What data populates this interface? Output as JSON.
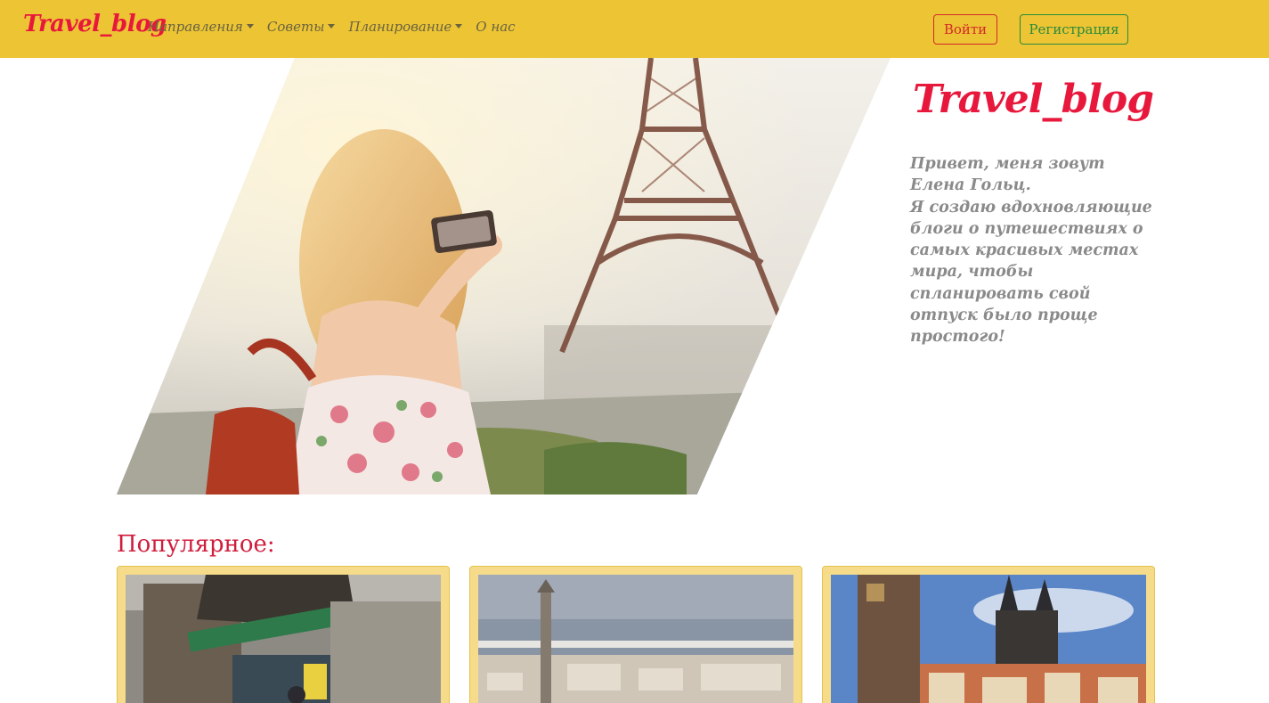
{
  "navbar": {
    "brand": "Travel_blog",
    "items": [
      {
        "label": "Направления",
        "dropdown": true
      },
      {
        "label": "Советы",
        "dropdown": true
      },
      {
        "label": "Планирование",
        "dropdown": true
      },
      {
        "label": "О нас",
        "dropdown": false
      }
    ],
    "login_label": "Войти",
    "register_label": "Регистрация"
  },
  "hero": {
    "title": "Travel_blog",
    "lines": [
      "Привет, меня зовут Елена Гольц.",
      "Я создаю вдохновляющие блоги о путешествиях о самых красивых местах мира, чтобы спланировать свой отпуск было проще простого!"
    ]
  },
  "popular": {
    "title": "Популярное:",
    "cards": [
      {
        "image": "city-street-photo"
      },
      {
        "image": "harbor-city-photo"
      },
      {
        "image": "old-town-square-photo"
      }
    ]
  },
  "colors": {
    "navbar_bg": "#ecc434",
    "brand": "#e8183c",
    "nav_text": "#6b6340",
    "login": "#d42a2a",
    "register": "#2a8a3a",
    "card_bg": "#f6dc8a"
  }
}
